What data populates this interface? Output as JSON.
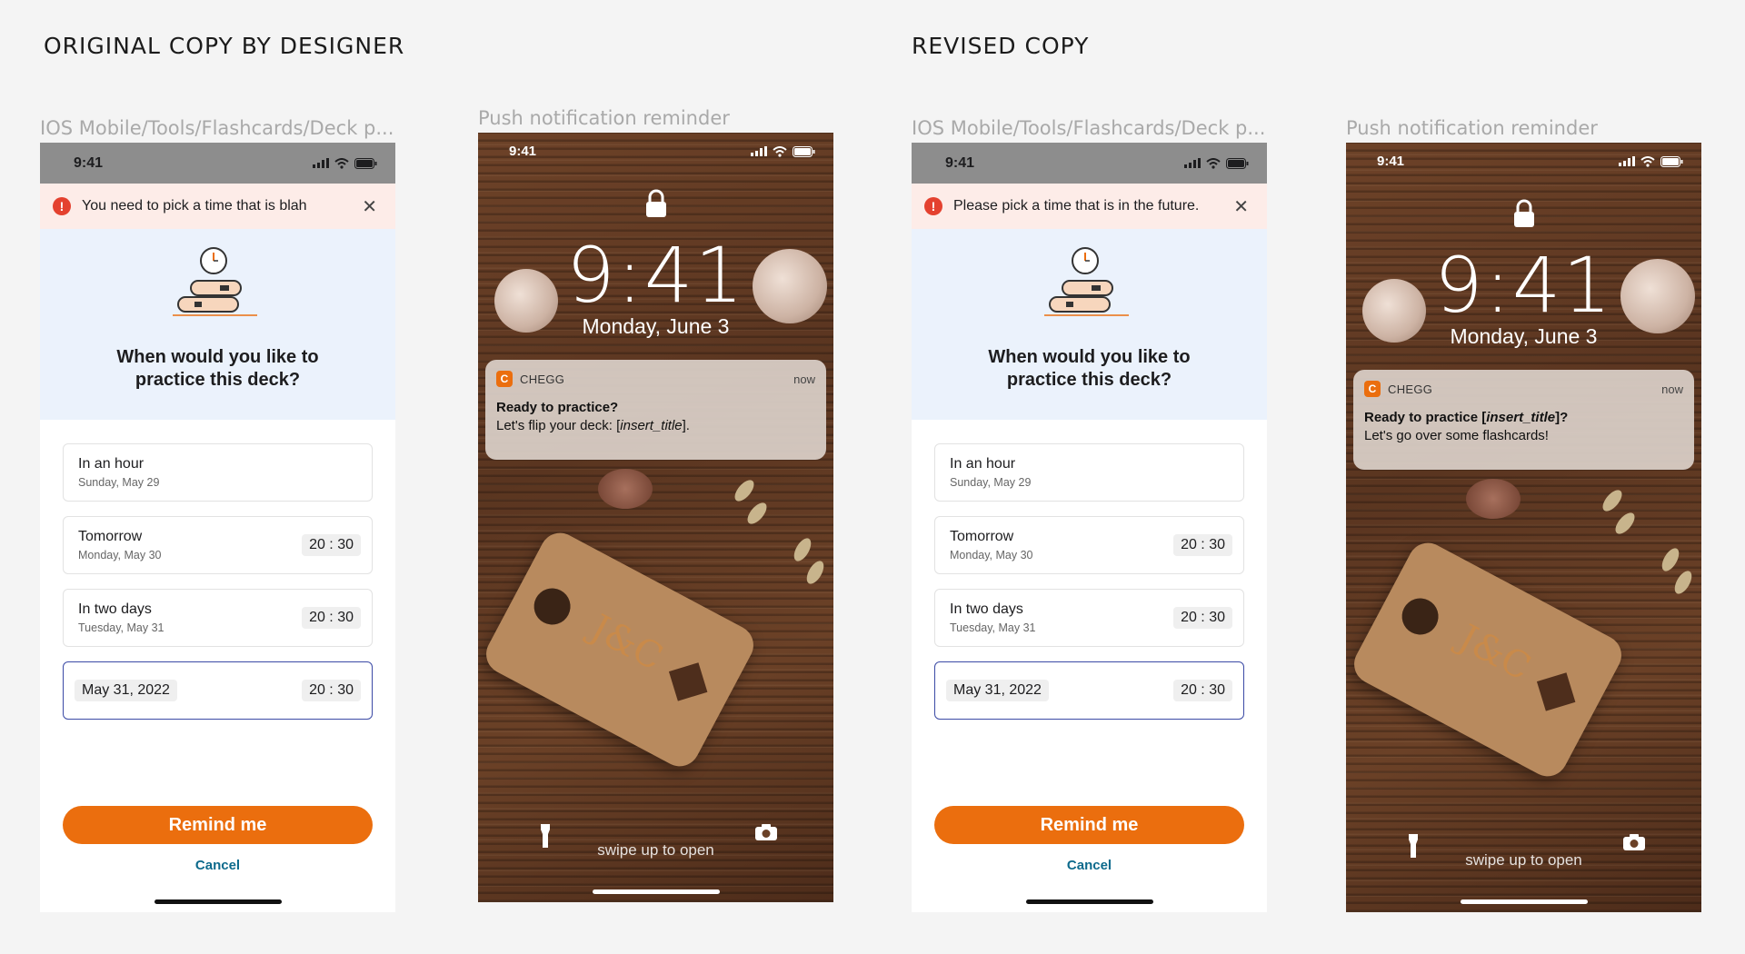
{
  "sections": {
    "left_title": "ORIGINAL COPY BY DESIGNER",
    "right_title": "REVISED COPY"
  },
  "labels": {
    "deck_frame": "IOS Mobile/Tools/Flashcards/Deck p...",
    "push_frame": "Push notification reminder"
  },
  "status_time": "9:41",
  "original": {
    "alert": "You need to pick a time that is blah"
  },
  "revised": {
    "alert": "Please pick a time that is in the future."
  },
  "modal": {
    "question_line1": "When would you like to",
    "question_line2": "practice this deck?",
    "options": [
      {
        "title": "In an hour",
        "sub": "Sunday, May 29",
        "time": ""
      },
      {
        "title": "Tomorrow",
        "sub": "Monday, May 30",
        "time": "20 : 30"
      },
      {
        "title": "In two days",
        "sub": "Tuesday, May 31",
        "time": "20 : 30"
      }
    ],
    "custom_date": "May 31, 2022",
    "custom_time": "20 : 30",
    "remind_label": "Remind me",
    "cancel_label": "Cancel"
  },
  "lock": {
    "clock": "9:41",
    "date": "Monday, June 3",
    "app_name": "CHEGG",
    "app_initial": "C",
    "when": "now",
    "swipe": "swipe up to open",
    "tag_initials": "J&C"
  },
  "notif_original": {
    "title": "Ready to practice?",
    "body_prefix": "Let's flip your deck: [",
    "body_var": "insert_title",
    "body_suffix": "]."
  },
  "notif_revised": {
    "title_prefix": "Ready to practice [",
    "title_var": "insert_title",
    "title_suffix": "]?",
    "body": "Let's go over some flashcards!"
  },
  "colors": {
    "accent": "#eb6e0e",
    "error": "#e4412f",
    "selected_border": "#3b4aa5",
    "link": "#0d6a8c"
  },
  "icons": [
    "signal-icon",
    "wifi-icon",
    "battery-icon",
    "error-icon",
    "close-icon",
    "clock-books-illustration",
    "lock-icon",
    "flashlight-icon",
    "camera-icon"
  ]
}
